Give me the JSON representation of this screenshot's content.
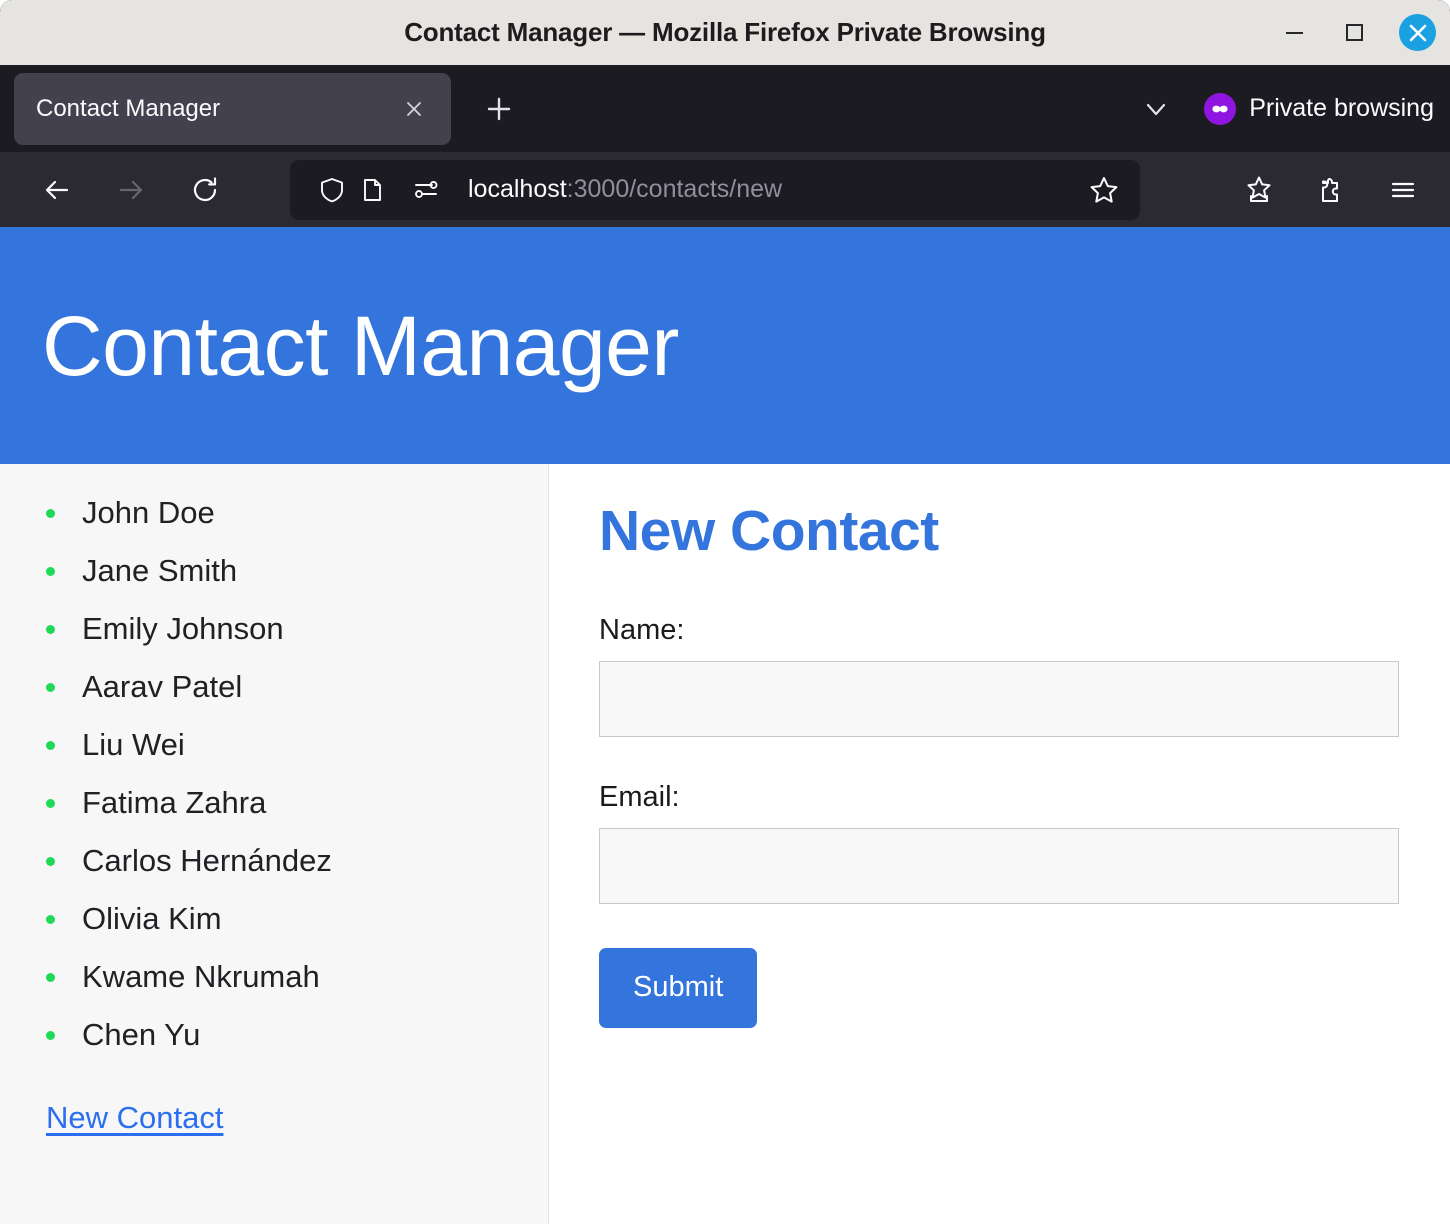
{
  "window": {
    "title": "Contact Manager — Mozilla Firefox Private Browsing",
    "minimize_label": "Minimize",
    "maximize_label": "Maximize",
    "close_label": "Close",
    "close_button_color": "#1ba1e2",
    "titlebar_color": "#e6e4e1"
  },
  "tabstrip": {
    "tabs": [
      {
        "title": "Contact Manager",
        "close_label": "Close tab",
        "active": true
      }
    ],
    "new_tab_label": "Open a new tab",
    "list_all_tabs_label": "List all tabs",
    "private_browsing_label": "Private browsing",
    "private_badge_color": "#8f16e0"
  },
  "navbar": {
    "back_label": "Go back one page",
    "forward_label": "Go forward one page",
    "reload_label": "Reload current page",
    "shield_label": "Tracking protection",
    "page_icon_label": "Page info",
    "permissions_label": "Site permissions",
    "url_host": "localhost",
    "url_path": ":3000/contacts/new",
    "url_full": "localhost:3000/contacts/new",
    "bookmark_label": "Bookmark this page",
    "bookmarks_label": "Bookmarks",
    "extensions_label": "Extensions",
    "menu_label": "Open application menu"
  },
  "page": {
    "header_title": "Contact Manager",
    "header_color": "#3375dc",
    "accent_color": "#3375dc",
    "bullet_color": "#1fd957",
    "sidebar": {
      "contacts": [
        "John Doe",
        "Jane Smith",
        "Emily Johnson",
        "Aarav Patel",
        "Liu Wei",
        "Fatima Zahra",
        "Carlos Hernández",
        "Olivia Kim",
        "Kwame Nkrumah",
        "Chen Yu"
      ],
      "new_contact_link": "New Contact"
    },
    "form": {
      "heading": "New Contact",
      "name_label": "Name:",
      "name_value": "",
      "name_placeholder": "",
      "email_label": "Email:",
      "email_value": "",
      "email_placeholder": "",
      "submit_label": "Submit"
    }
  }
}
